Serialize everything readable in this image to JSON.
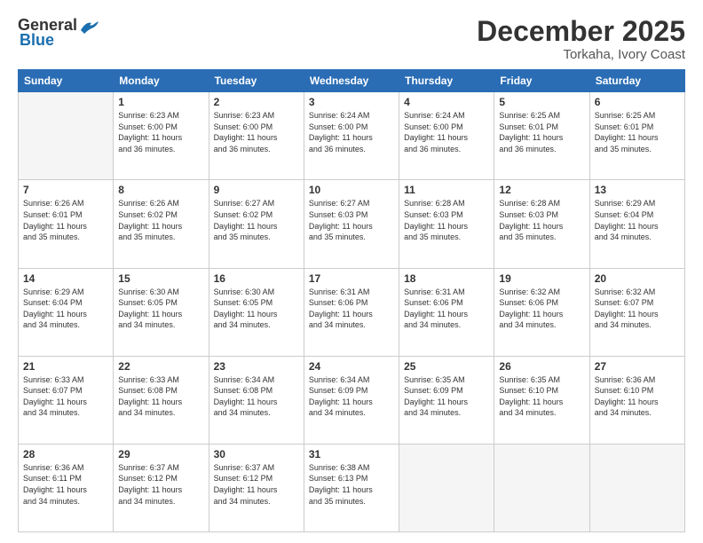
{
  "logo": {
    "general": "General",
    "blue": "Blue"
  },
  "header": {
    "month": "December 2025",
    "location": "Torkaha, Ivory Coast"
  },
  "days_of_week": [
    "Sunday",
    "Monday",
    "Tuesday",
    "Wednesday",
    "Thursday",
    "Friday",
    "Saturday"
  ],
  "weeks": [
    [
      {
        "num": "",
        "info": ""
      },
      {
        "num": "1",
        "info": "Sunrise: 6:23 AM\nSunset: 6:00 PM\nDaylight: 11 hours\nand 36 minutes."
      },
      {
        "num": "2",
        "info": "Sunrise: 6:23 AM\nSunset: 6:00 PM\nDaylight: 11 hours\nand 36 minutes."
      },
      {
        "num": "3",
        "info": "Sunrise: 6:24 AM\nSunset: 6:00 PM\nDaylight: 11 hours\nand 36 minutes."
      },
      {
        "num": "4",
        "info": "Sunrise: 6:24 AM\nSunset: 6:00 PM\nDaylight: 11 hours\nand 36 minutes."
      },
      {
        "num": "5",
        "info": "Sunrise: 6:25 AM\nSunset: 6:01 PM\nDaylight: 11 hours\nand 36 minutes."
      },
      {
        "num": "6",
        "info": "Sunrise: 6:25 AM\nSunset: 6:01 PM\nDaylight: 11 hours\nand 35 minutes."
      }
    ],
    [
      {
        "num": "7",
        "info": "Sunrise: 6:26 AM\nSunset: 6:01 PM\nDaylight: 11 hours\nand 35 minutes."
      },
      {
        "num": "8",
        "info": "Sunrise: 6:26 AM\nSunset: 6:02 PM\nDaylight: 11 hours\nand 35 minutes."
      },
      {
        "num": "9",
        "info": "Sunrise: 6:27 AM\nSunset: 6:02 PM\nDaylight: 11 hours\nand 35 minutes."
      },
      {
        "num": "10",
        "info": "Sunrise: 6:27 AM\nSunset: 6:03 PM\nDaylight: 11 hours\nand 35 minutes."
      },
      {
        "num": "11",
        "info": "Sunrise: 6:28 AM\nSunset: 6:03 PM\nDaylight: 11 hours\nand 35 minutes."
      },
      {
        "num": "12",
        "info": "Sunrise: 6:28 AM\nSunset: 6:03 PM\nDaylight: 11 hours\nand 35 minutes."
      },
      {
        "num": "13",
        "info": "Sunrise: 6:29 AM\nSunset: 6:04 PM\nDaylight: 11 hours\nand 34 minutes."
      }
    ],
    [
      {
        "num": "14",
        "info": "Sunrise: 6:29 AM\nSunset: 6:04 PM\nDaylight: 11 hours\nand 34 minutes."
      },
      {
        "num": "15",
        "info": "Sunrise: 6:30 AM\nSunset: 6:05 PM\nDaylight: 11 hours\nand 34 minutes."
      },
      {
        "num": "16",
        "info": "Sunrise: 6:30 AM\nSunset: 6:05 PM\nDaylight: 11 hours\nand 34 minutes."
      },
      {
        "num": "17",
        "info": "Sunrise: 6:31 AM\nSunset: 6:06 PM\nDaylight: 11 hours\nand 34 minutes."
      },
      {
        "num": "18",
        "info": "Sunrise: 6:31 AM\nSunset: 6:06 PM\nDaylight: 11 hours\nand 34 minutes."
      },
      {
        "num": "19",
        "info": "Sunrise: 6:32 AM\nSunset: 6:06 PM\nDaylight: 11 hours\nand 34 minutes."
      },
      {
        "num": "20",
        "info": "Sunrise: 6:32 AM\nSunset: 6:07 PM\nDaylight: 11 hours\nand 34 minutes."
      }
    ],
    [
      {
        "num": "21",
        "info": "Sunrise: 6:33 AM\nSunset: 6:07 PM\nDaylight: 11 hours\nand 34 minutes."
      },
      {
        "num": "22",
        "info": "Sunrise: 6:33 AM\nSunset: 6:08 PM\nDaylight: 11 hours\nand 34 minutes."
      },
      {
        "num": "23",
        "info": "Sunrise: 6:34 AM\nSunset: 6:08 PM\nDaylight: 11 hours\nand 34 minutes."
      },
      {
        "num": "24",
        "info": "Sunrise: 6:34 AM\nSunset: 6:09 PM\nDaylight: 11 hours\nand 34 minutes."
      },
      {
        "num": "25",
        "info": "Sunrise: 6:35 AM\nSunset: 6:09 PM\nDaylight: 11 hours\nand 34 minutes."
      },
      {
        "num": "26",
        "info": "Sunrise: 6:35 AM\nSunset: 6:10 PM\nDaylight: 11 hours\nand 34 minutes."
      },
      {
        "num": "27",
        "info": "Sunrise: 6:36 AM\nSunset: 6:10 PM\nDaylight: 11 hours\nand 34 minutes."
      }
    ],
    [
      {
        "num": "28",
        "info": "Sunrise: 6:36 AM\nSunset: 6:11 PM\nDaylight: 11 hours\nand 34 minutes."
      },
      {
        "num": "29",
        "info": "Sunrise: 6:37 AM\nSunset: 6:12 PM\nDaylight: 11 hours\nand 34 minutes."
      },
      {
        "num": "30",
        "info": "Sunrise: 6:37 AM\nSunset: 6:12 PM\nDaylight: 11 hours\nand 34 minutes."
      },
      {
        "num": "31",
        "info": "Sunrise: 6:38 AM\nSunset: 6:13 PM\nDaylight: 11 hours\nand 35 minutes."
      },
      {
        "num": "",
        "info": ""
      },
      {
        "num": "",
        "info": ""
      },
      {
        "num": "",
        "info": ""
      }
    ]
  ]
}
